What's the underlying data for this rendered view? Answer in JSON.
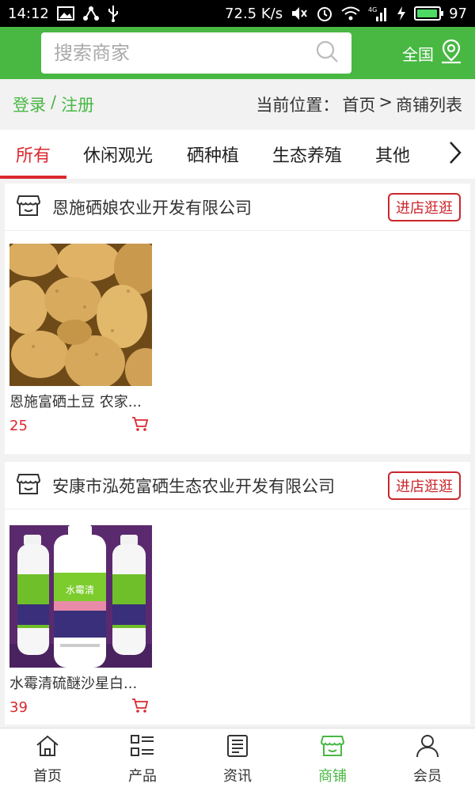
{
  "status_bar": {
    "time": "14:12",
    "speed": "72.5 K/s",
    "network": "4G",
    "battery": "97",
    "battery_fraction": 0.97
  },
  "header": {
    "search_placeholder": "搜索商家",
    "region_label": "全国"
  },
  "subbar": {
    "login": "登录",
    "separator": "/",
    "register": "注册",
    "location_label": "当前位置：",
    "crumb_home": "首页",
    "crumb_sep": ">",
    "crumb_current": "商铺列表"
  },
  "tabs": [
    {
      "label": "所有",
      "active": true
    },
    {
      "label": "休闲观光"
    },
    {
      "label": "硒种植"
    },
    {
      "label": "生态养殖"
    },
    {
      "label": "其他"
    }
  ],
  "shops": [
    {
      "name": "恩施硒娘农业开发有限公司",
      "enter_label": "进店逛逛",
      "product": {
        "title": "恩施富硒土豆 农家...",
        "price": "25"
      }
    },
    {
      "name": "安康市泓苑富硒生态农业开发有限公司",
      "enter_label": "进店逛逛",
      "product": {
        "title": "水霉清硫醚沙星白...",
        "price": "39",
        "bottle_label": "水霉清"
      }
    }
  ],
  "bottom_nav": [
    {
      "label": "首页",
      "icon": "home-icon"
    },
    {
      "label": "产品",
      "icon": "grid-list-icon"
    },
    {
      "label": "资讯",
      "icon": "news-icon"
    },
    {
      "label": "商铺",
      "icon": "store-icon",
      "active": true
    },
    {
      "label": "会员",
      "icon": "user-icon"
    }
  ],
  "colors": {
    "brand_green": "#48b843",
    "accent_red": "#d9282e"
  }
}
